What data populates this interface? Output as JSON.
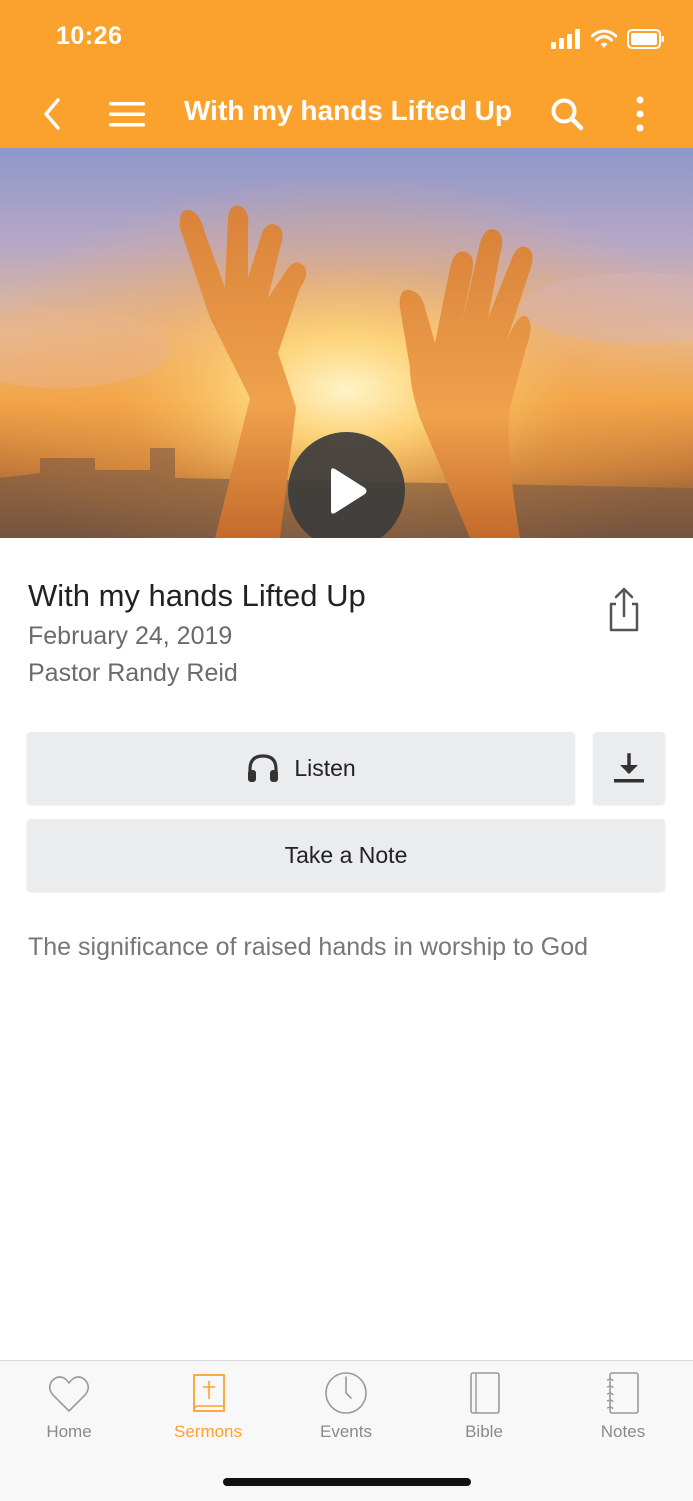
{
  "status_bar": {
    "time": "10:26"
  },
  "nav": {
    "title": "With my hands Lifted Up",
    "back_icon": "chevron-left-icon",
    "menu_icon": "hamburger-icon",
    "search_icon": "search-icon",
    "more_icon": "vertical-dots-icon"
  },
  "hero": {
    "play_icon": "play-icon"
  },
  "sermon": {
    "title": "With my hands Lifted Up",
    "date": "February 24, 2019",
    "pastor": "Pastor Randy Reid",
    "description": "The significance of raised hands in worship to God"
  },
  "actions": {
    "listen_label": "Listen",
    "take_note_label": "Take a Note"
  },
  "tabs": [
    {
      "label": "Home",
      "icon": "heart-icon",
      "active": false
    },
    {
      "label": "Sermons",
      "icon": "book-cross-icon",
      "active": true
    },
    {
      "label": "Events",
      "icon": "clock-icon",
      "active": false
    },
    {
      "label": "Bible",
      "icon": "bible-icon",
      "active": false
    },
    {
      "label": "Notes",
      "icon": "notebook-icon",
      "active": false
    }
  ],
  "colors": {
    "accent": "#fba22e",
    "button_bg": "#ebecee",
    "muted_text": "#6b6b6b",
    "tab_inactive": "#8a8a8a"
  }
}
